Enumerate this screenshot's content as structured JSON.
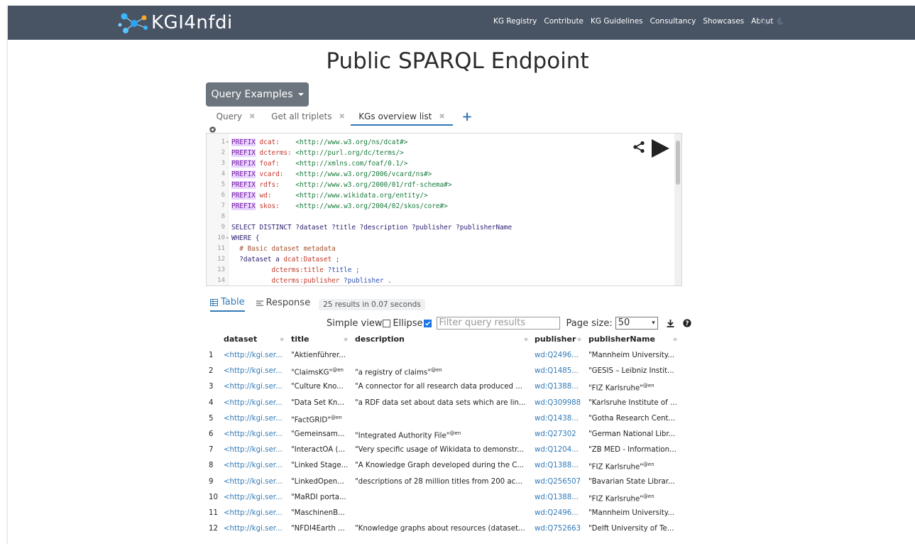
{
  "nav": {
    "logo": "KGI4nfdi",
    "links": [
      "KG Registry",
      "Contribute",
      "KG Guidelines",
      "Consultancy",
      "Showcases",
      "About"
    ]
  },
  "page_title": "Public SPARQL Endpoint",
  "query_examples_label": "Query Examples",
  "tabs": [
    {
      "label": "Query"
    },
    {
      "label": "Get all triplets"
    },
    {
      "label": "KGs overview list"
    }
  ],
  "tab_add": "+",
  "editor": {
    "lines": [
      {
        "n": "1",
        "fold": "▾",
        "kw": "PREFIX",
        "pfx": "dcat:",
        "pad": "    ",
        "uri": "<http://www.w3.org/ns/dcat#>"
      },
      {
        "n": "2",
        "kw": "PREFIX",
        "pfx": "dcterms:",
        "pad": " ",
        "uri": "<http://purl.org/dc/terms/>"
      },
      {
        "n": "3",
        "kw": "PREFIX",
        "pfx": "foaf:",
        "pad": "    ",
        "uri": "<http://xmlns.com/foaf/0.1/>"
      },
      {
        "n": "4",
        "kw": "PREFIX",
        "pfx": "vcard:",
        "pad": "   ",
        "uri": "<http://www.w3.org/2006/vcard/ns#>"
      },
      {
        "n": "5",
        "kw": "PREFIX",
        "pfx": "rdfs:",
        "pad": "    ",
        "uri": "<http://www.w3.org/2000/01/rdf-schema#>"
      },
      {
        "n": "6",
        "kw": "PREFIX",
        "pfx": "wd:",
        "pad": "      ",
        "uri": "<http://www.wikidata.org/entity/>"
      },
      {
        "n": "7",
        "kw": "PREFIX",
        "pfx": "skos:",
        "pad": "    ",
        "uri": "<http://www.w3.org/2004/02/skos/core#>"
      },
      {
        "n": "8",
        "text": ""
      },
      {
        "n": "9",
        "text": "SELECT DISTINCT ?dataset ?title ?description ?publisher ?publisherName"
      },
      {
        "n": "10",
        "fold": "▾",
        "text": "WHERE {"
      },
      {
        "n": "11",
        "comment": "  # Basic dataset metadata"
      },
      {
        "n": "12",
        "text": "  ?dataset a ",
        "pfx2": "dcat:Dataset",
        "tail": " ;"
      },
      {
        "n": "13",
        "text": "          ",
        "pfx2": "dcterms:title",
        "tail": " ?title ;"
      },
      {
        "n": "14",
        "text": "          ",
        "pfx2": "dcterms:publisher",
        "tail": " ?publisher ."
      }
    ]
  },
  "results": {
    "table_tab": "Table",
    "response_tab": "Response",
    "count": "25 results in 0.07 seconds",
    "simple_view": "Simple view",
    "ellipse": "Ellipse",
    "filter_placeholder": "Filter query results",
    "page_size_label": "Page size:",
    "page_size_value": "50",
    "headers": [
      "dataset",
      "title",
      "description",
      "publisher",
      "publisherName"
    ],
    "rows": [
      {
        "n": "1",
        "dataset": "<http://kgi.ser...",
        "title": "\"Aktienführer...",
        "description": "",
        "publisher": "wd:Q2496...",
        "name": "\"Mannheim University..."
      },
      {
        "n": "2",
        "dataset": "<http://kgi.ser...",
        "title": "\"ClaimsKG\"",
        "title_sup": "@en",
        "description": "\"a registry of claims\"",
        "desc_sup": "@en",
        "publisher": "wd:Q1485...",
        "name": "\"GESIS – Leibniz Instit..."
      },
      {
        "n": "3",
        "dataset": "<http://kgi.ser...",
        "title": "\"Culture Kno...",
        "description": "\"A connector for all research data produced ...",
        "publisher": "wd:Q1388...",
        "name": "\"FIZ Karlsruhe\"",
        "name_sup": "@en"
      },
      {
        "n": "4",
        "dataset": "<http://kgi.ser...",
        "title": "\"Data Set Kn...",
        "description": "\"a RDF data set about data sets which are lin...",
        "publisher": "wd:Q309988",
        "name": "\"Karlsruhe Institute of ..."
      },
      {
        "n": "5",
        "dataset": "<http://kgi.ser...",
        "title": "\"FactGRID\"",
        "title_sup": "@en",
        "description": "",
        "publisher": "wd:Q1438...",
        "name": "\"Gotha Research Cent..."
      },
      {
        "n": "6",
        "dataset": "<http://kgi.ser...",
        "title": "\"Gemeinsam...",
        "description": "\"Integrated Authority File\"",
        "desc_sup": "@en",
        "publisher": "wd:Q27302",
        "name": "\"German National Libr..."
      },
      {
        "n": "7",
        "dataset": "<http://kgi.ser...",
        "title": "\"InteractOA (...",
        "description": "\"Very specific usage of Wikidata to demonstr...",
        "publisher": "wd:Q1204...",
        "name": "\"ZB MED - Information..."
      },
      {
        "n": "8",
        "dataset": "<http://kgi.ser...",
        "title": "\"Linked Stage...",
        "description": "\"A Knowledge Graph developed during the C...",
        "publisher": "wd:Q1388...",
        "name": "\"FIZ Karlsruhe\"",
        "name_sup": "@en"
      },
      {
        "n": "9",
        "dataset": "<http://kgi.ser...",
        "title": "\"LinkedOpen...",
        "description": "\"descriptions of 28 million titles from 200 ac...",
        "publisher": "wd:Q256507",
        "name": "\"Bavarian State Librar..."
      },
      {
        "n": "10",
        "dataset": "<http://kgi.ser...",
        "title": "\"MaRDI porta...",
        "description": "",
        "publisher": "wd:Q1388...",
        "name": "\"FIZ Karlsruhe\"",
        "name_sup": "@en"
      },
      {
        "n": "11",
        "dataset": "<http://kgi.ser...",
        "title": "\"MaschinenB...",
        "description": "",
        "publisher": "wd:Q2496...",
        "name": "\"Mannheim University..."
      },
      {
        "n": "12",
        "dataset": "<http://kgi.ser...",
        "title": "\"NFDI4Earth ...",
        "description": "\"Knowledge graphs about resources (dataset...",
        "publisher": "wd:Q752663",
        "name": "\"Delft University of Te..."
      }
    ]
  },
  "colors": {
    "navbar": "#485364",
    "link": "#337ab7",
    "button": "#6c757d"
  }
}
